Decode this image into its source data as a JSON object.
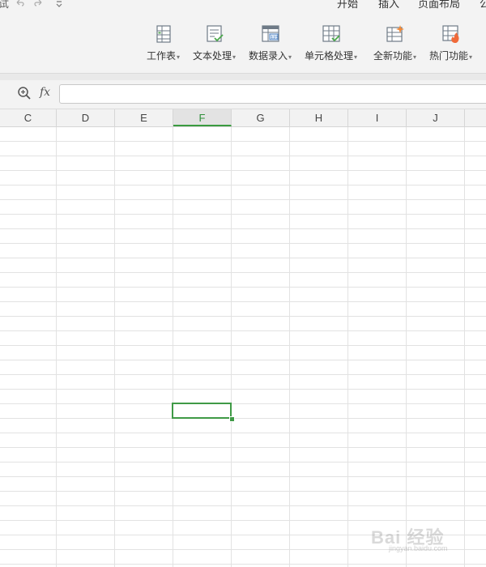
{
  "quick_access": {
    "undo_icon": "undo-icon",
    "redo_icon": "redo-icon",
    "more_icon": "chevron-down-icon",
    "clipped_char": "试"
  },
  "menu_tabs": [
    "开始",
    "插入",
    "页面布局",
    "公"
  ],
  "ribbon": {
    "buttons": [
      {
        "label": "工作表",
        "icon": "worksheet-icon"
      },
      {
        "label": "文本处理",
        "icon": "text-process-icon"
      },
      {
        "label": "数据录入",
        "icon": "data-entry-icon"
      },
      {
        "label": "单元格处理",
        "icon": "cell-process-icon"
      },
      {
        "label": "全新功能",
        "icon": "new-feature-icon"
      },
      {
        "label": "热门功能",
        "icon": "hot-feature-icon"
      }
    ],
    "dropdown_arrow": "▾"
  },
  "formula_bar": {
    "zoom_icon": "zoom-search-icon",
    "fx_label": "fx",
    "value": ""
  },
  "columns": [
    "C",
    "D",
    "E",
    "F",
    "G",
    "H",
    "I",
    "J"
  ],
  "active_column": "F",
  "watermark": {
    "text": "Bai 经验",
    "sub": "jingyan.baidu.com"
  },
  "colors": {
    "accent_green": "#3a9b3f",
    "grid_line": "#e2e2e2",
    "header_bg": "#f2f2f2"
  }
}
